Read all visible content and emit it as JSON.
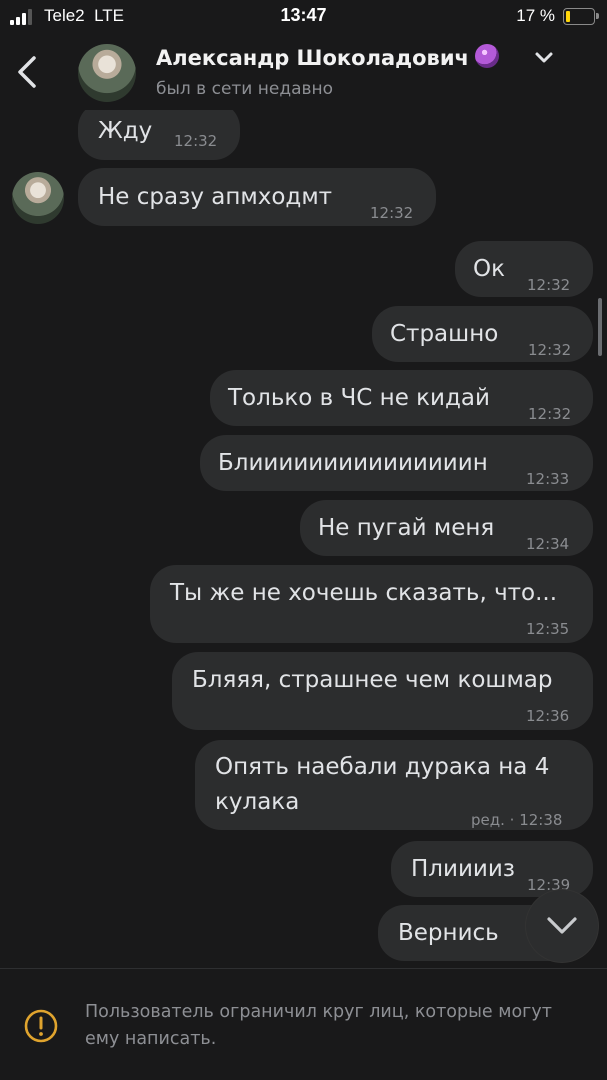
{
  "status_bar": {
    "carrier": "Tele2",
    "network": "LTE",
    "time": "13:47",
    "battery": "17 %",
    "battery_level": 0.17,
    "battery_color": "#ffd60a"
  },
  "header": {
    "contact_name": "Александр Шоколадович",
    "name_icon": "crystal-ball-icon",
    "status": "был в сети недавно"
  },
  "messages": [
    {
      "side": "incoming",
      "text": "Жду",
      "time": "12:32"
    },
    {
      "side": "incoming",
      "text": "Не сразу апмходмт",
      "time": "12:32"
    },
    {
      "side": "outgoing",
      "text": "Ок",
      "time": "12:32"
    },
    {
      "side": "outgoing",
      "text": "Страшно",
      "time": "12:32"
    },
    {
      "side": "outgoing",
      "text": "Только в ЧС не кидай",
      "time": "12:32"
    },
    {
      "side": "outgoing",
      "text": "Блииииииииииииииин",
      "time": "12:33"
    },
    {
      "side": "outgoing",
      "text": "Не пугай меня",
      "time": "12:34"
    },
    {
      "side": "outgoing",
      "text": "Ты же не хочешь сказать, что...",
      "time": "12:35"
    },
    {
      "side": "outgoing",
      "text": "Бляяя, страшнее чем кошмар",
      "time": "12:36"
    },
    {
      "side": "outgoing",
      "text_line1": "Опять наебали дурака на 4",
      "text_line2": "кулака",
      "edited": "ред. · ",
      "time": "12:38"
    },
    {
      "side": "outgoing",
      "text": "Плииииз",
      "time": "12:39"
    },
    {
      "side": "outgoing",
      "text": "Вернись",
      "time": ""
    }
  ],
  "footer": {
    "notice": "Пользователь ограничил круг лиц, которые могут ему написать.",
    "icon": "warning-icon"
  },
  "colors": {
    "background": "#19191a",
    "bubble": "#2c2d2e",
    "text": "#e1e3e6",
    "muted": "#8d8f94"
  }
}
